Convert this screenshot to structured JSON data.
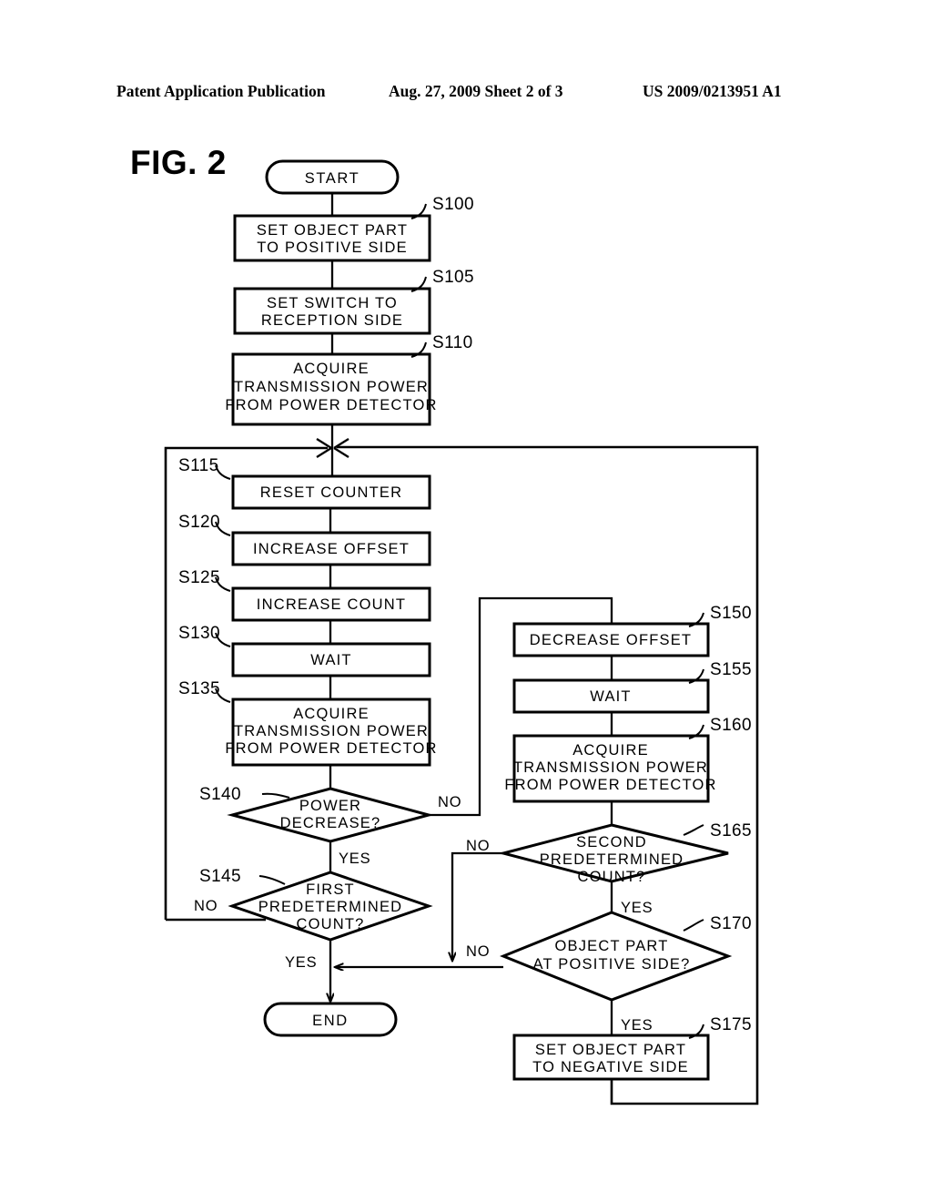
{
  "header": {
    "left": "Patent Application Publication",
    "middle": "Aug. 27, 2009  Sheet 2 of 3",
    "right": "US 2009/0213951 A1"
  },
  "figure": {
    "label": "FIG. 2"
  },
  "nodes": {
    "start": {
      "id": "START",
      "text": "START",
      "shape": "terminator"
    },
    "end": {
      "id": "END",
      "text": "END",
      "shape": "terminator"
    },
    "s100": {
      "id": "S100",
      "shape": "process",
      "lines": [
        "SET OBJECT PART",
        "TO POSITIVE SIDE"
      ]
    },
    "s105": {
      "id": "S105",
      "shape": "process",
      "lines": [
        "SET SWITCH TO",
        "RECEPTION SIDE"
      ]
    },
    "s110": {
      "id": "S110",
      "shape": "process",
      "lines": [
        "ACQUIRE",
        "TRANSMISSION POWER",
        "FROM POWER DETECTOR"
      ]
    },
    "s115": {
      "id": "S115",
      "shape": "process",
      "lines": [
        "RESET COUNTER"
      ]
    },
    "s120": {
      "id": "S120",
      "shape": "process",
      "lines": [
        "INCREASE OFFSET"
      ]
    },
    "s125": {
      "id": "S125",
      "shape": "process",
      "lines": [
        "INCREASE COUNT"
      ]
    },
    "s130": {
      "id": "S130",
      "shape": "process",
      "lines": [
        "WAIT"
      ]
    },
    "s135": {
      "id": "S135",
      "shape": "process",
      "lines": [
        "ACQUIRE",
        "TRANSMISSION POWER",
        "FROM POWER DETECTOR"
      ]
    },
    "s140": {
      "id": "S140",
      "shape": "decision",
      "lines": [
        "POWER",
        "DECREASE?"
      ],
      "yes": "YES",
      "no": "NO"
    },
    "s145": {
      "id": "S145",
      "shape": "decision",
      "lines": [
        "FIRST",
        "PREDETERMINED",
        "COUNT?"
      ],
      "yes": "YES",
      "no": "NO"
    },
    "s150": {
      "id": "S150",
      "shape": "process",
      "lines": [
        "DECREASE OFFSET"
      ]
    },
    "s155": {
      "id": "S155",
      "shape": "process",
      "lines": [
        "WAIT"
      ]
    },
    "s160": {
      "id": "S160",
      "shape": "process",
      "lines": [
        "ACQUIRE",
        "TRANSMISSION POWER",
        "FROM POWER DETECTOR"
      ]
    },
    "s165": {
      "id": "S165",
      "shape": "decision",
      "lines": [
        "SECOND",
        "PREDETERMINED",
        "COUNT?"
      ],
      "yes": "YES",
      "no": "NO"
    },
    "s170": {
      "id": "S170",
      "shape": "decision",
      "lines": [
        "OBJECT PART",
        "AT POSITIVE SIDE?"
      ],
      "yes": "YES",
      "no": "NO"
    },
    "s175": {
      "id": "S175",
      "shape": "process",
      "lines": [
        "SET OBJECT PART",
        "TO NEGATIVE SIDE"
      ]
    }
  },
  "colors": {
    "ink": "#000000",
    "paper": "#ffffff"
  }
}
